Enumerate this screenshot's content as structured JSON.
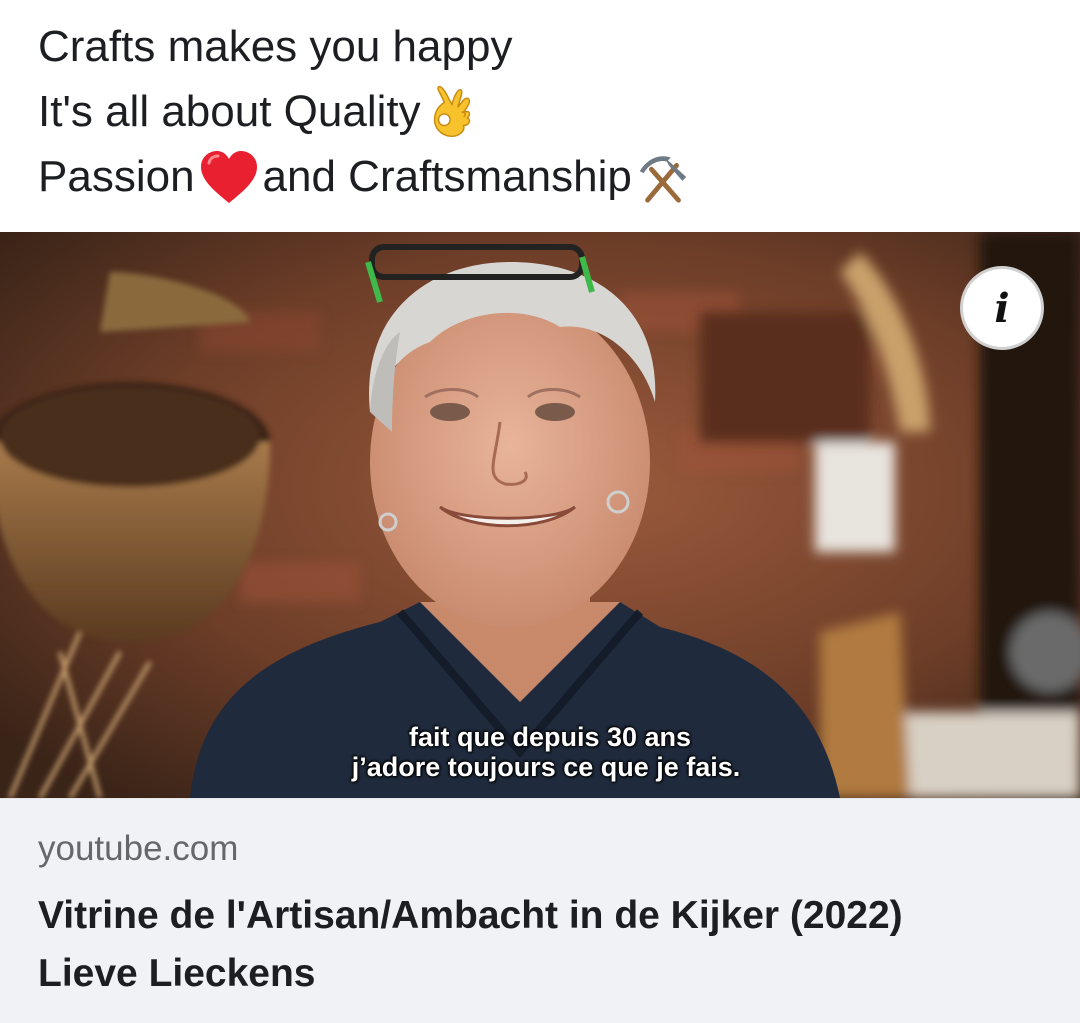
{
  "post": {
    "line1": "Crafts makes you happy",
    "line2": "It's all about Quality",
    "line2_emoji": "ok-hand-emoji",
    "line3_a": "Passion",
    "line3_heart": "red-heart-emoji",
    "line3_b": "and Craftsmanship",
    "line3_emoji": "hammer-and-pick-emoji"
  },
  "video": {
    "subtitle_line1": "fait que depuis 30 ans",
    "subtitle_line2": "j’adore toujours ce que je fais.",
    "info_icon": "i"
  },
  "link": {
    "domain": "youtube.com",
    "title_line1": "Vitrine de l'Artisan/Ambacht in de Kijker (2022)",
    "title_line2": "Lieve Lieckens"
  },
  "colors": {
    "text": "#1c1e21",
    "secondary": "#65676b",
    "card_bg": "#f0f2f5",
    "heart": "#e8202f",
    "emoji_yellow": "#f7c22c"
  }
}
